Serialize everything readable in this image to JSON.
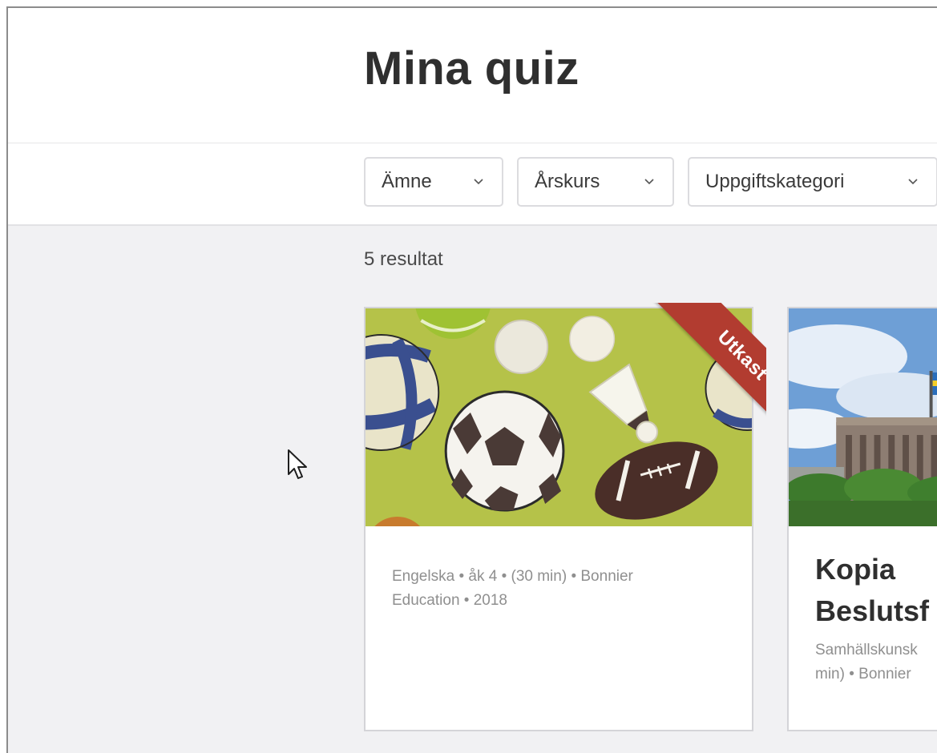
{
  "header": {
    "title": "Mina quiz"
  },
  "filters": [
    {
      "label": "Ämne"
    },
    {
      "label": "Årskurs"
    },
    {
      "label": "Uppgiftskategori"
    }
  ],
  "results": {
    "count_label": "5 resultat"
  },
  "cards": [
    {
      "image": "sports-balls-image",
      "ribbon": "Utkast",
      "meta_line1": "Engelska • åk 4 • (30 min) • Bonnier",
      "meta_line2": "Education • 2018"
    },
    {
      "image": "swedish-parliament-image",
      "title_line1": "Kopia",
      "title_line2": "Beslutsf",
      "meta_line1": "Samhällskunsk",
      "meta_line2": "min) • Bonnier"
    }
  ],
  "colors": {
    "ribbon": "#b23c30",
    "image_background": "#b5c249",
    "page_background": "#f1f1f3"
  }
}
